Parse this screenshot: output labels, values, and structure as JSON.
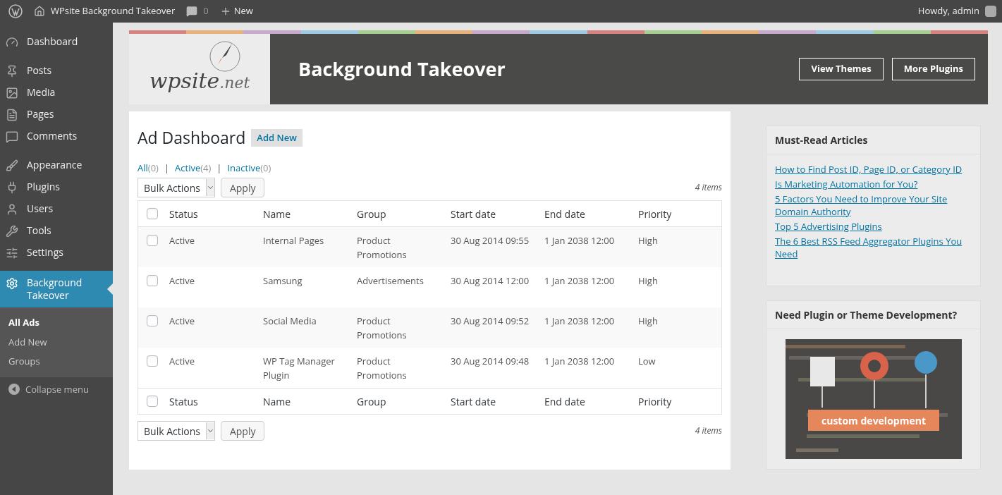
{
  "admin_bar": {
    "site_title": "WPsite Background Takeover",
    "comments_count": "0",
    "new_label": "New",
    "greeting": "Howdy, admin"
  },
  "sidebar": {
    "items": [
      {
        "label": "Dashboard",
        "selected": false
      },
      {
        "label": "Posts",
        "selected": false
      },
      {
        "label": "Media",
        "selected": false
      },
      {
        "label": "Pages",
        "selected": false
      },
      {
        "label": "Comments",
        "selected": false
      },
      {
        "label": "Appearance",
        "selected": false
      },
      {
        "label": "Plugins",
        "selected": false
      },
      {
        "label": "Users",
        "selected": false
      },
      {
        "label": "Tools",
        "selected": false
      },
      {
        "label": "Settings",
        "selected": false
      },
      {
        "label": "Background Takeover",
        "selected": true
      }
    ],
    "submenu": [
      {
        "label": "All Ads",
        "selected": true
      },
      {
        "label": "Add New",
        "selected": false
      },
      {
        "label": "Groups",
        "selected": false
      }
    ],
    "collapse_label": "Collapse menu"
  },
  "header": {
    "logo_text": "wpsite",
    "logo_suffix": ".net",
    "title": "Background Takeover",
    "buttons": [
      "View Themes",
      "More Plugins"
    ]
  },
  "main": {
    "title": "Ad Dashboard",
    "add_new": "Add New",
    "filters": [
      {
        "label": "All",
        "count": "(0)",
        "selected": false
      },
      {
        "separator": "|",
        "label": "Active",
        "count": "(4)",
        "selected": false
      },
      {
        "separator": "|",
        "label": "Inactive",
        "count": "(0)",
        "selected": false
      }
    ],
    "top_bar": {
      "bulk_actions": "Bulk Actions",
      "apply": "Apply",
      "items_count": "4 items"
    },
    "table": {
      "header": {
        "checked": false,
        "columns": [
          "Status",
          "Name",
          "Group",
          "Start date",
          "End date",
          "Priority"
        ]
      },
      "footer": {
        "checked": false,
        "columns": [
          "Status",
          "Name",
          "Group",
          "Start date",
          "End date",
          "Priority"
        ]
      },
      "rows": [
        {
          "checked": false,
          "cells": [
            "Active",
            "Internal Pages",
            "Product Promotions",
            "30 Aug 2014 09:55",
            "1 Jan 2038 12:00",
            "High"
          ]
        },
        {
          "checked": false,
          "cells": [
            "Active",
            "Samsung",
            "Advertisements",
            "30 Aug 2014 12:00",
            "1 Jan 2038 12:00",
            "High"
          ]
        },
        {
          "checked": false,
          "cells": [
            "Active",
            "Social Media",
            "Product Promotions",
            "30 Aug 2014 09:52",
            "1 Jan 2038 12:00",
            "High"
          ]
        },
        {
          "checked": false,
          "cells": [
            "Active",
            "WP Tag Manager Plugin",
            "Product Promotions",
            "30 Aug 2014 09:48",
            "1 Jan 2038 12:00",
            "Low"
          ]
        }
      ]
    },
    "bottom_bar": {
      "bulk_actions": "Bulk Actions",
      "apply": "Apply",
      "items_count": "4 items"
    }
  },
  "widgets": [
    {
      "title": "Must-Read Articles",
      "links": [
        "How to Find Post ID, Page ID, or Category ID",
        "Is Marketing Automation for You?",
        "5 Factors You Need to Improve Your Site Domain Authority",
        "Top 5 Advertising Plugins",
        "The 6 Best RSS Feed Aggregator Plugins You Need"
      ]
    },
    {
      "title": "Need Plugin or Theme Development?",
      "banner": "custom development"
    }
  ]
}
